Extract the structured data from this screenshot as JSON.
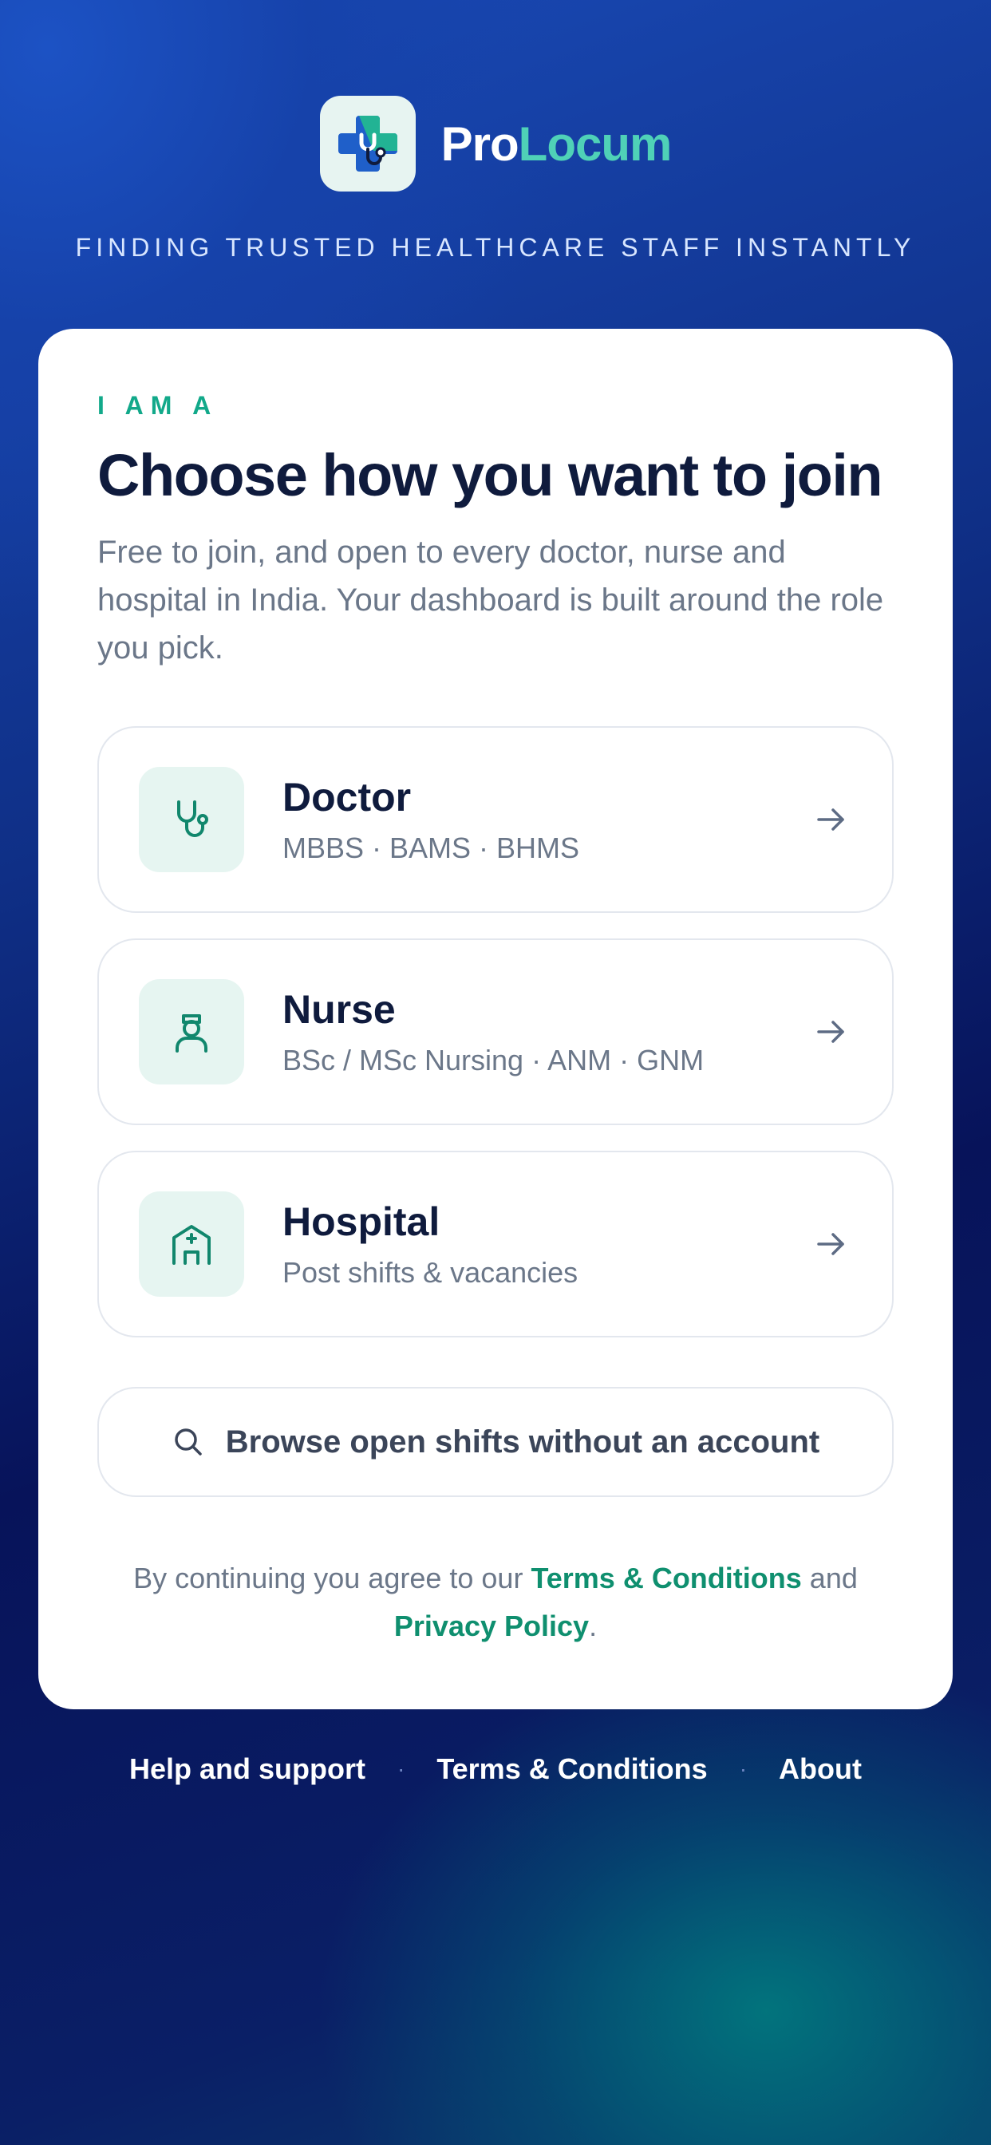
{
  "brand": {
    "name_part1": "Pro",
    "name_part2": "Locum",
    "logo_icon": "stethoscope-cross-icon",
    "tagline": "FINDING TRUSTED HEALTHCARE STAFF INSTANTLY"
  },
  "card": {
    "eyebrow": "I AM A",
    "heading": "Choose how you want to join",
    "subtext": "Free to join, and open to every doctor, nurse and hospital in India. Your dashboard is built around the role you pick.",
    "roles": [
      {
        "title": "Doctor",
        "desc": "MBBS · BAMS · BHMS",
        "icon": "stethoscope-icon"
      },
      {
        "title": "Nurse",
        "desc": "BSc / MSc Nursing · ANM · GNM",
        "icon": "nurse-icon"
      },
      {
        "title": "Hospital",
        "desc": "Post shifts & vacancies",
        "icon": "hospital-icon"
      }
    ],
    "browse_label": "Browse open shifts without an account",
    "legal": {
      "prefix": "By continuing you agree to our ",
      "terms": "Terms & Conditions",
      "middle": " and ",
      "privacy": "Privacy Policy",
      "suffix": "."
    }
  },
  "footer": {
    "links": [
      "Help and support",
      "Terms & Conditions",
      "About"
    ],
    "separator": "·"
  },
  "colors": {
    "accent": "#12a98a",
    "brand_teal": "#4fd1b7",
    "heading": "#0f1b3d",
    "muted": "#6b7789",
    "background_blue": "#0f2f86"
  }
}
